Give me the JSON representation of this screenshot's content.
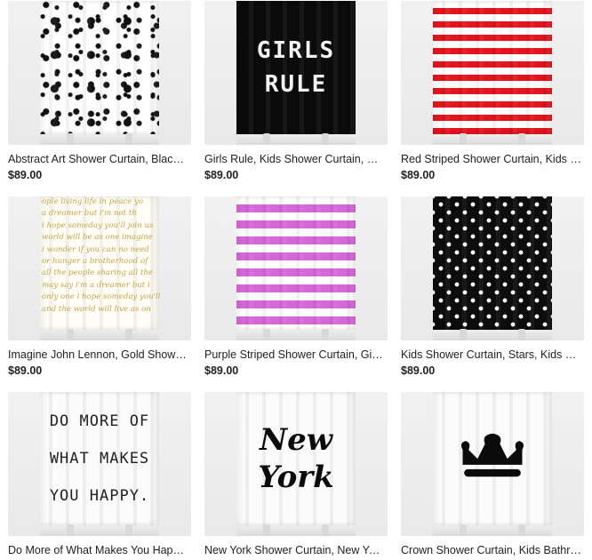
{
  "products": [
    {
      "title": "Abstract Art Shower Curtain, Blac…",
      "price": "$89.00",
      "art": "splatter"
    },
    {
      "title": "Girls Rule, Kids Shower Curtain, G…",
      "price": "$89.00",
      "art": "girls",
      "art_text": [
        "GIRLS",
        "RULE"
      ]
    },
    {
      "title": "Red Striped Shower Curtain, Kids …",
      "price": "$89.00",
      "art": "stripes-red"
    },
    {
      "title": "Imagine John Lennon, Gold Show…",
      "price": "$89.00",
      "art": "lyrics",
      "art_text": [
        "ople living life in peace yo",
        "a dreamer but i'm not th",
        "i hope someday you'll join us",
        "world will be as one imagine",
        "i wonder if you can no need",
        "or hunger a brotherhood of",
        "all the people sharing all the",
        "may say i'm a dreamer but i",
        "only one i hope someday you'll",
        "and the world will live as on"
      ]
    },
    {
      "title": "Purple Striped Shower Curtain, Gi…",
      "price": "$89.00",
      "art": "stripes-purple"
    },
    {
      "title": "Kids Shower Curtain, Stars, Kids B…",
      "price": "$89.00",
      "art": "stars"
    },
    {
      "title": "Do More of What Makes You Happ…",
      "price": "",
      "art": "domore",
      "art_text": [
        "DO MORE OF",
        "WHAT MAKES",
        "YOU HAPPY."
      ]
    },
    {
      "title": "New York Shower Curtain, New Yo…",
      "price": "",
      "art": "newyork",
      "art_text": [
        "New",
        "York"
      ]
    },
    {
      "title": "Crown Shower Curtain, Kids Bathr…",
      "price": "",
      "art": "crown"
    }
  ]
}
